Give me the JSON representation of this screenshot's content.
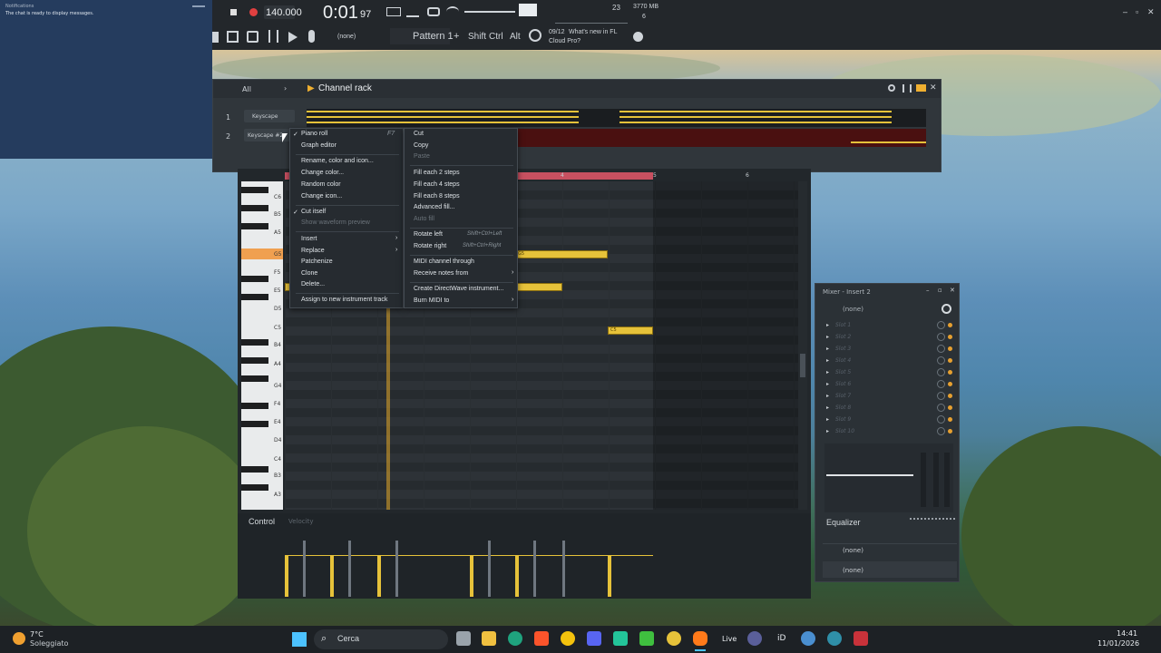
{
  "colors": {
    "accent_yellow": "#e6c23a",
    "orange_key": "#f0a050",
    "chat_bg": "#253c5e",
    "dark_bg": "#22272b"
  },
  "chat": {
    "title": "Notifications",
    "message": "The chat is ready to display messages."
  },
  "toolbar": {
    "tempo": "140.000",
    "time_main": "0:01",
    "time_sub": "97",
    "cpu": "23",
    "memory": "3770 MB",
    "polyphony": "6",
    "pattern": "Pattern 1",
    "none_label": "(none)",
    "shift": "Shift",
    "ctrl": "Ctrl",
    "alt": "Alt",
    "news_date": "09/12",
    "news_text_1": "What's new in FL",
    "news_text_2": "Cloud Pro?"
  },
  "channel_rack": {
    "title": "Channel rack",
    "filter": "All",
    "channels": [
      {
        "num": "1",
        "name": "Keyscape"
      },
      {
        "num": "2",
        "name": "Keyscape #2"
      }
    ]
  },
  "piano_roll": {
    "keys": [
      "C6",
      "B5",
      "A5",
      "G5",
      "F5",
      "E5",
      "D5",
      "C5",
      "B4",
      "A4",
      "G4",
      "F4",
      "E4",
      "D4",
      "C4",
      "B3",
      "A3"
    ],
    "bar_numbers": [
      "4",
      "5",
      "6"
    ],
    "control_label": "Control",
    "control_sub": "Velocity",
    "note_labels": [
      "G5",
      "C5"
    ]
  },
  "mixer": {
    "title": "Mixer - Insert 2",
    "input": "(none)",
    "slots": [
      "Slot 1",
      "Slot 2",
      "Slot 3",
      "Slot 4",
      "Slot 5",
      "Slot 6",
      "Slot 7",
      "Slot 8",
      "Slot 9",
      "Slot 10"
    ],
    "equalizer": "Equalizer",
    "out1": "(none)",
    "out2": "(none)"
  },
  "menu_left": {
    "items": [
      {
        "label": "Piano roll",
        "check": "✓",
        "shortcut": "F7"
      },
      {
        "label": "Graph editor"
      },
      {
        "label": "Rename, color and icon..."
      },
      {
        "label": "Change color..."
      },
      {
        "label": "Random color"
      },
      {
        "label": "Change icon..."
      },
      {
        "label": "Cut itself",
        "check": "✓"
      },
      {
        "label": "Show waveform preview"
      },
      {
        "label": "Insert"
      },
      {
        "label": "Replace"
      },
      {
        "label": "Patchenize"
      },
      {
        "label": "Clone"
      },
      {
        "label": "Delete..."
      },
      {
        "label": "Assign to new instrument track"
      }
    ]
  },
  "menu_right": {
    "items": [
      {
        "label": "Cut"
      },
      {
        "label": "Copy"
      },
      {
        "label": "Paste"
      },
      {
        "label": "Fill each 2 steps"
      },
      {
        "label": "Fill each 4 steps"
      },
      {
        "label": "Fill each 8 steps"
      },
      {
        "label": "Advanced fill..."
      },
      {
        "label": "Auto fill"
      },
      {
        "label": "Rotate left",
        "shortcut": "Shift+Ctrl+Left"
      },
      {
        "label": "Rotate right",
        "shortcut": "Shift+Ctrl+Right"
      },
      {
        "label": "MIDI channel through"
      },
      {
        "label": "Receive notes from"
      },
      {
        "label": "Create DirectWave instrument..."
      },
      {
        "label": "Burn MIDI to"
      }
    ]
  },
  "taskbar": {
    "temp": "7°C",
    "weather": "Soleggiato",
    "search": "Cerca",
    "time": "14:41",
    "date": "11/01/2026",
    "live": "Live",
    "id": "iD"
  }
}
